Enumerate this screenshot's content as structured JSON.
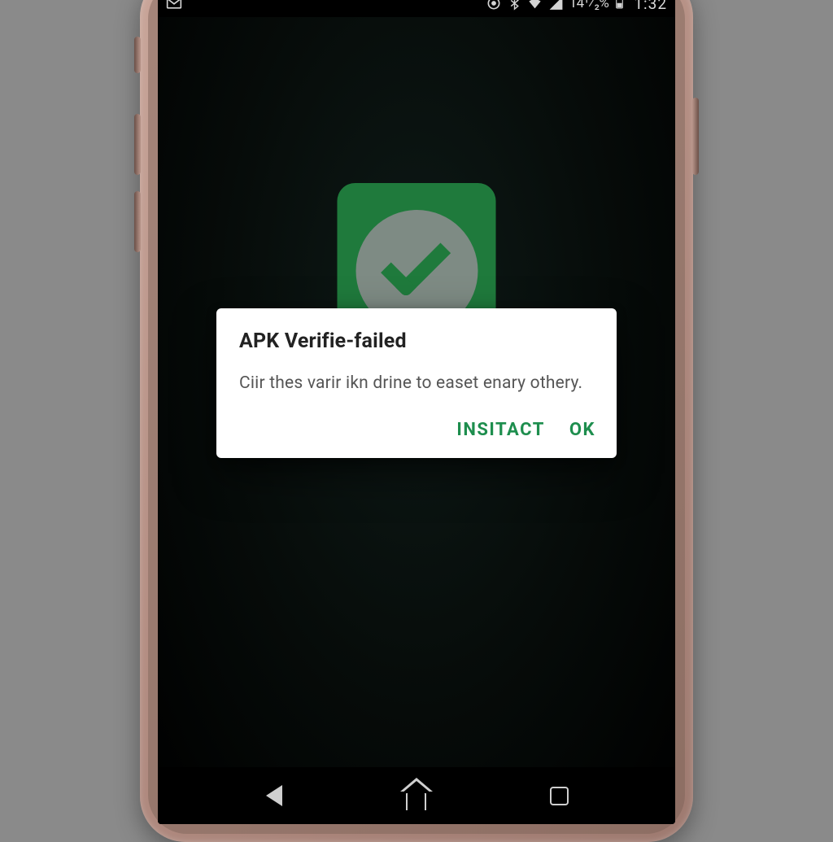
{
  "status_bar": {
    "clock": "1:32",
    "battery_percent": "14¹⁄₂%",
    "icons": {
      "mail": "mail-icon",
      "target": "target-icon",
      "bluetooth": "bluetooth-icon",
      "wifi": "wifi-icon",
      "signal": "signal-icon",
      "battery": "battery-icon"
    }
  },
  "app_icon": {
    "name": "verify-check-icon"
  },
  "dialog": {
    "title": "APK Verifie-failed",
    "body": "Ciir thes varir ikn drine to easet enary othery.",
    "actions": {
      "primary": "INSITACT",
      "secondary": "OK"
    }
  },
  "navbar": {
    "back": "back-button",
    "home": "home-button",
    "recents": "recents-button"
  },
  "colors": {
    "accent": "#1e8e4e",
    "dialog_bg": "#ffffff",
    "screen_bg": "#060b09"
  }
}
